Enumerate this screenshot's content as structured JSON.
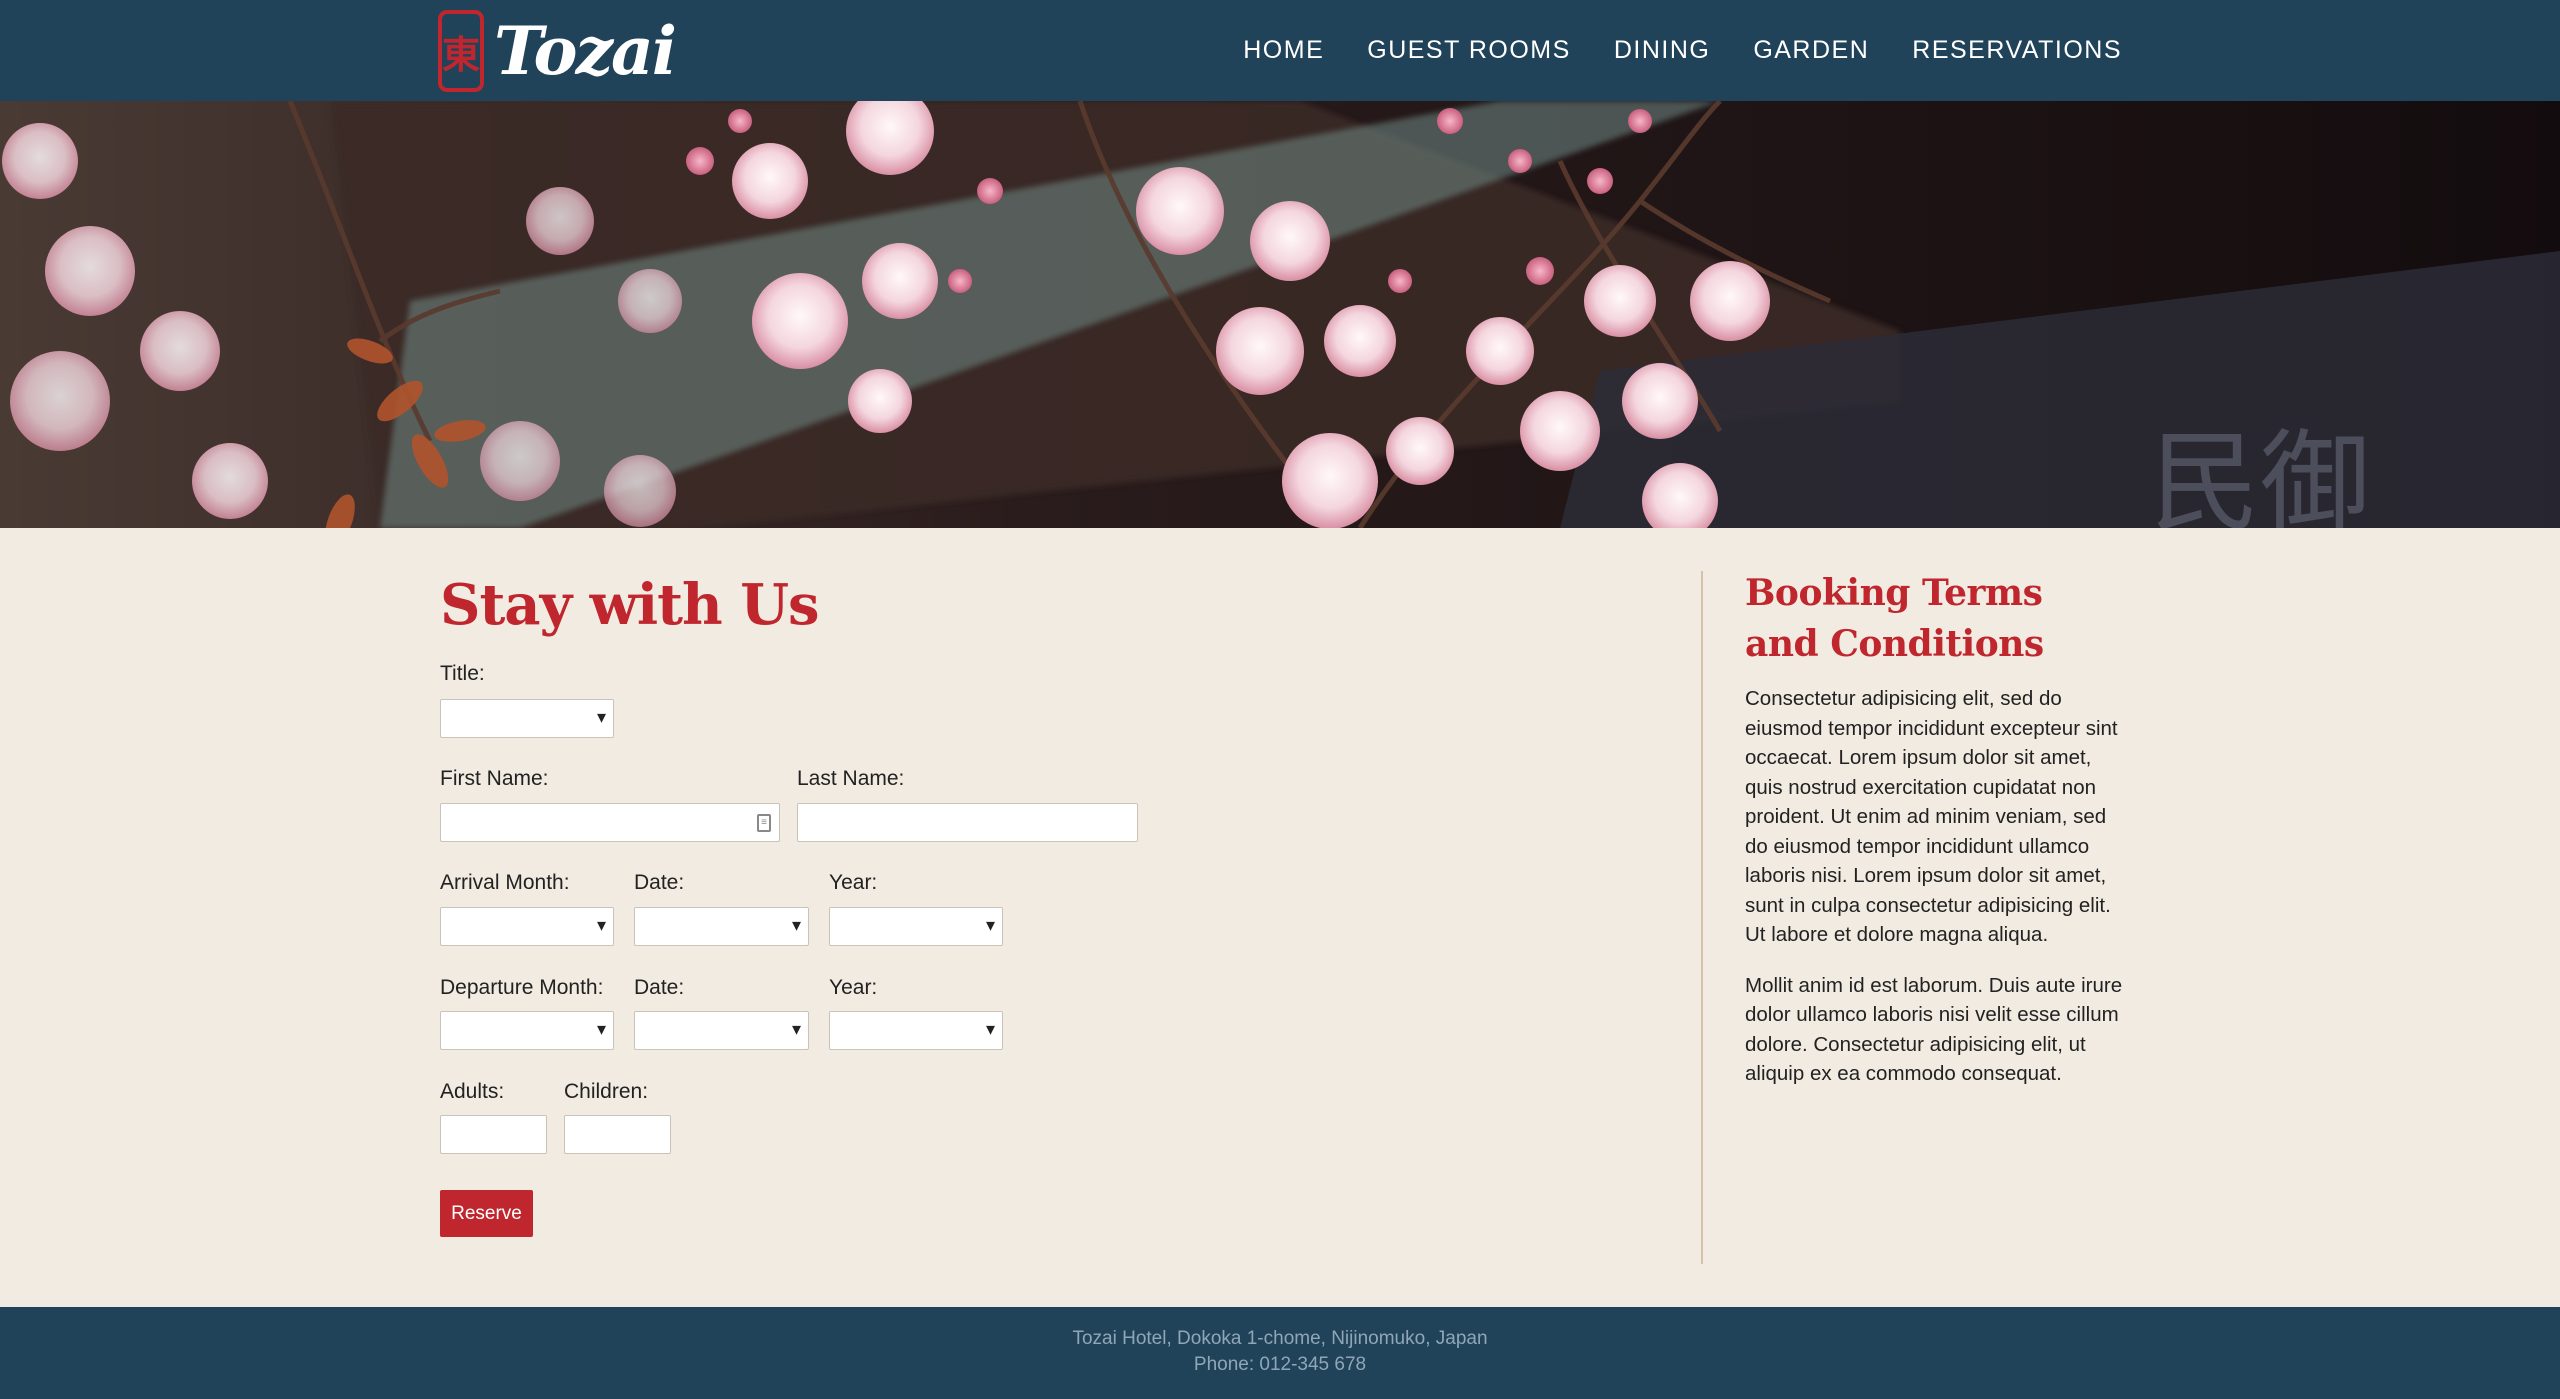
{
  "brand": {
    "name": "Tozai",
    "logo_glyph": "東",
    "colors": {
      "header": "#21435a",
      "accent": "#c0262d",
      "page": "#f2ebe1",
      "footer_text": "#8fa6b7"
    }
  },
  "nav": {
    "items": [
      {
        "label": "HOME"
      },
      {
        "label": "GUEST ROOMS"
      },
      {
        "label": "DINING"
      },
      {
        "label": "GARDEN"
      },
      {
        "label": "RESERVATIONS"
      }
    ]
  },
  "hero": {
    "icon": "cherry-blossom-photo"
  },
  "form": {
    "title": "Stay with Us",
    "labels": {
      "title": "Title:",
      "first_name": "First Name:",
      "last_name": "Last Name:",
      "arrival_month": "Arrival Month:",
      "arrival_date": "Date:",
      "arrival_year": "Year:",
      "departure_month": "Departure Month:",
      "departure_date": "Date:",
      "departure_year": "Year:",
      "adults": "Adults:",
      "children": "Children:"
    },
    "values": {
      "title": "",
      "first_name": "",
      "last_name": "",
      "arrival_month": "",
      "arrival_date": "",
      "arrival_year": "",
      "departure_month": "",
      "departure_date": "",
      "departure_year": "",
      "adults": "",
      "children": ""
    },
    "reserve_label": "Reserve"
  },
  "terms": {
    "title": "Booking Terms and Conditions",
    "paragraphs": [
      "Consectetur adipisicing elit, sed do eiusmod tempor incididunt excepteur sint occaecat. Lorem ipsum dolor sit amet, quis nostrud exercitation cupidatat non proident. Ut enim ad minim veniam, sed do eiusmod tempor incididunt ullamco laboris nisi. Lorem ipsum dolor sit amet, sunt in culpa consectetur adipisicing elit. Ut labore et dolore magna aliqua.",
      "Mollit anim id est laborum. Duis aute irure dolor ullamco laboris nisi velit esse cillum dolore. Consectetur adipisicing elit, ut aliquip ex ea commodo consequat."
    ]
  },
  "footer": {
    "address": "Tozai Hotel, Dokoka 1-chome, Nijinomuko, Japan",
    "phone": "Phone: 012-345 678"
  }
}
